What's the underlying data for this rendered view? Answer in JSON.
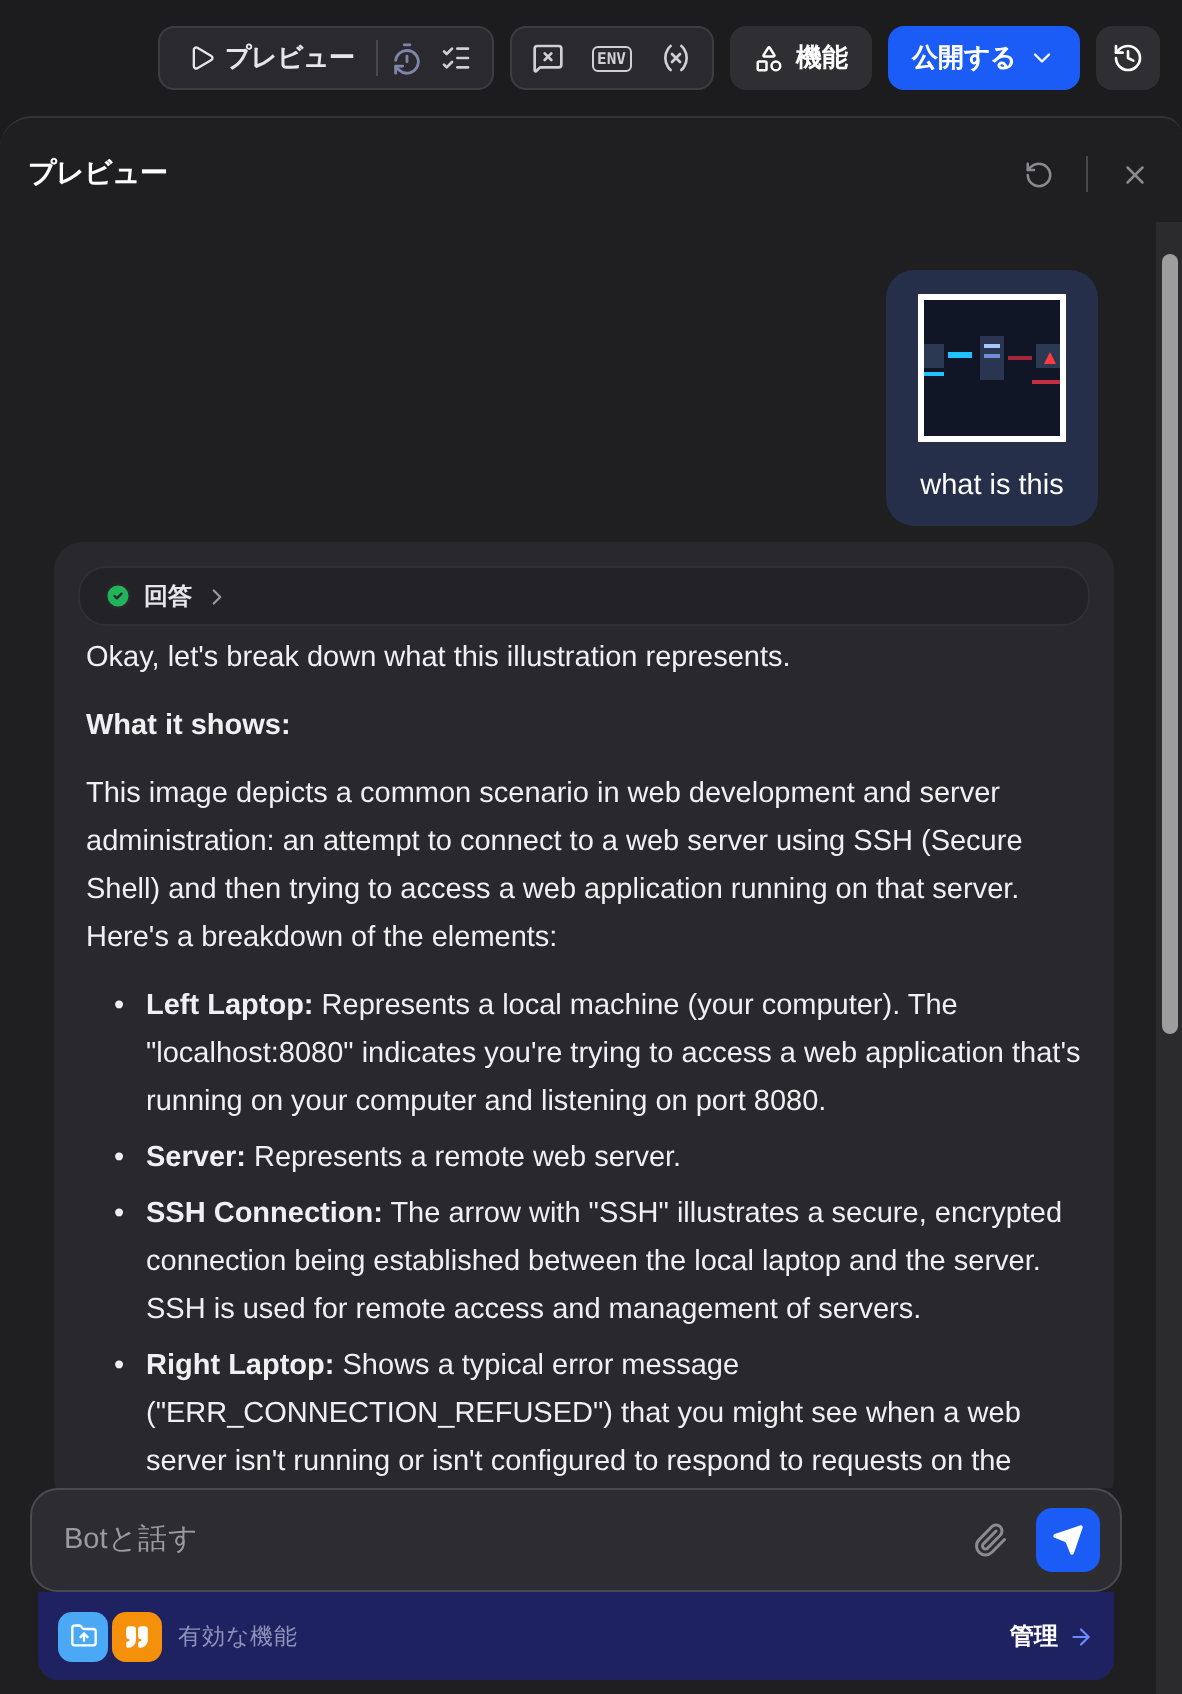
{
  "toolbar": {
    "preview_button": "プレビュー",
    "env_label": "ENV",
    "features_button": "機能",
    "publish_button": "公開する"
  },
  "panel": {
    "title": "プレビュー"
  },
  "messages": [
    {
      "kind": "user",
      "has_picture": true,
      "text": "what is this"
    },
    {
      "kind": "bot",
      "status": "回答",
      "blocks": [
        {
          "kind": "paragraph",
          "text": "Okay, let's break down what this illustration represents."
        },
        {
          "kind": "heading",
          "text": "What it shows:"
        },
        {
          "kind": "paragraph",
          "text": "This image depicts a common scenario in web development and server administration: an attempt to connect to a web server using SSH (Secure Shell) and then trying to access a web application running on that server. Here's a breakdown of the elements:"
        },
        {
          "kind": "list",
          "marker": "•",
          "items": [
            "**Left Laptop:** Represents a local machine (your computer). The \"localhost:8080\" indicates you're trying to access a web application that's running on your computer and listening on port 8080.",
            "**Server:** Represents a remote web server.",
            "**SSH Connection:** The arrow with \"SSH\" illustrates a secure, encrypted connection being established between the local laptop and the server. SSH is used for remote access and management of servers.",
            "**Right Laptop:** Shows a typical error message (\"ERR_CONNECTION_REFUSED\") that you might see when a web server isn't running or isn't configured to respond to requests on the"
          ]
        }
      ]
    }
  ],
  "composer": {
    "placeholder": "Botと話す"
  },
  "features_bar": {
    "label": "有効な機能",
    "manage_link": "管理"
  }
}
